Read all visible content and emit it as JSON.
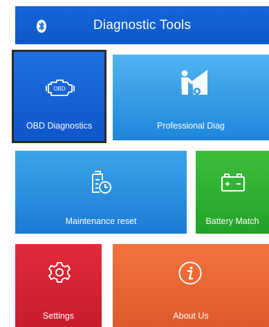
{
  "header": {
    "title": "Diagnostic Tools",
    "bluetooth_icon": "bluetooth-icon"
  },
  "tiles": [
    {
      "id": "obd",
      "label": "OBD Diagnostics",
      "icon": "engine-check-icon",
      "color": "#1565d8",
      "selected": true
    },
    {
      "id": "professional",
      "label": "Professional Diag",
      "icon": "mechanic-car-icon",
      "color": "#2b95e3"
    },
    {
      "id": "maintenance",
      "label": "Maintenance reset",
      "icon": "maintenance-clock-icon",
      "color": "#2a8fe0"
    },
    {
      "id": "battery",
      "label": "Battery Match",
      "icon": "battery-icon",
      "color": "#2fb033"
    },
    {
      "id": "settings",
      "label": "Settings",
      "icon": "gear-icon",
      "color": "#d52232"
    },
    {
      "id": "about",
      "label": "About Us",
      "icon": "info-icon",
      "color": "#e86634"
    }
  ]
}
